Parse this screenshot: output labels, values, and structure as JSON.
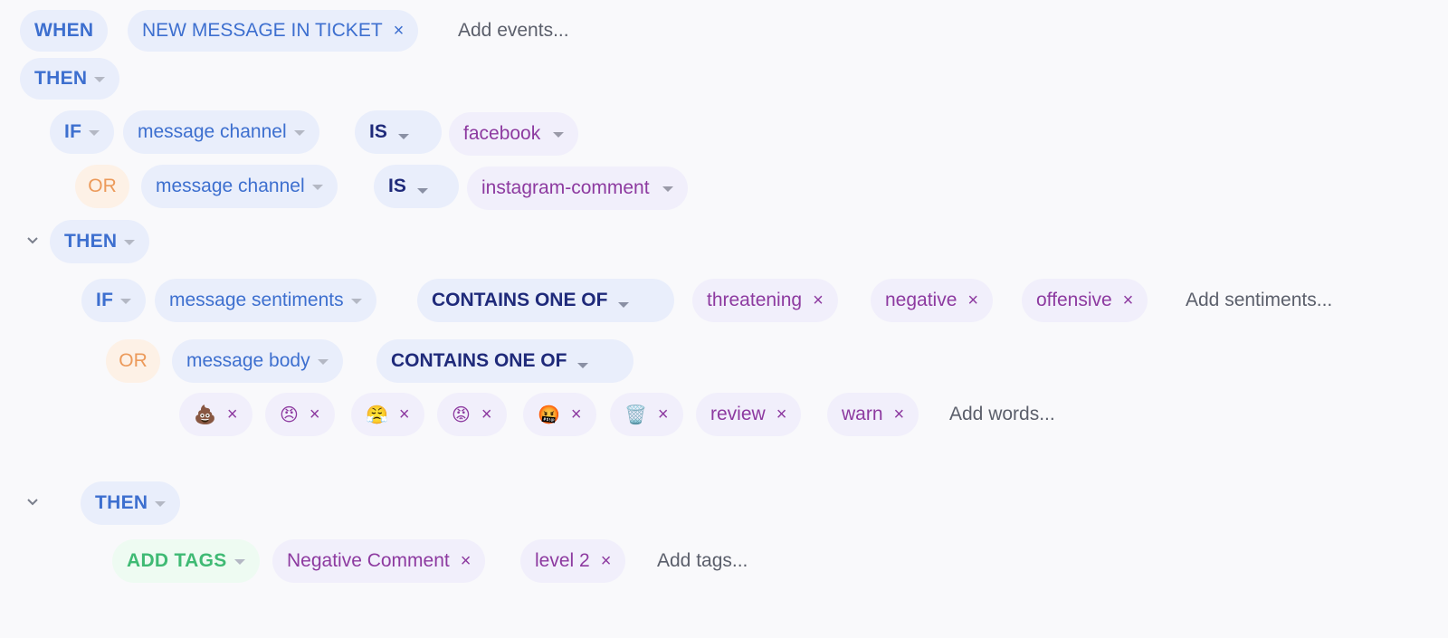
{
  "trigger": {
    "when_label": "WHEN",
    "event_tag": "NEW MESSAGE IN TICKET",
    "add_events_placeholder": "Add events..."
  },
  "then1_label": "THEN",
  "cond1": {
    "if_label": "IF",
    "field": "message channel",
    "operator": "IS",
    "value": "facebook"
  },
  "cond1_or": {
    "or_label": "OR",
    "field": "message channel",
    "operator": "IS",
    "value": "instagram-comment"
  },
  "then2_label": "THEN",
  "cond2": {
    "if_label": "IF",
    "field": "message sentiments",
    "operator": "CONTAINS ONE OF",
    "values": [
      "threatening",
      "negative",
      "offensive"
    ],
    "add_placeholder": "Add sentiments..."
  },
  "cond2_or": {
    "or_label": "OR",
    "field": "message body",
    "operator": "CONTAINS ONE OF",
    "words": [
      "💩",
      "😠",
      "😤",
      "😡",
      "🤬",
      "🗑️",
      "review",
      "warn"
    ],
    "add_placeholder": "Add words..."
  },
  "then3_label": "THEN",
  "action": {
    "label": "ADD TAGS",
    "tags": [
      "Negative Comment",
      "level 2"
    ],
    "add_placeholder": "Add tags..."
  },
  "colors": {
    "blue_text": "#3d6fcf",
    "navy_text": "#1f2a7a",
    "purple_text": "#8d3aa0",
    "orange_text": "#ec9a5a",
    "green_text": "#3fba74",
    "page_bg": "#f9f9fb"
  },
  "icons": [
    "chevron-down-icon",
    "close-icon",
    "caret-down-icon"
  ]
}
